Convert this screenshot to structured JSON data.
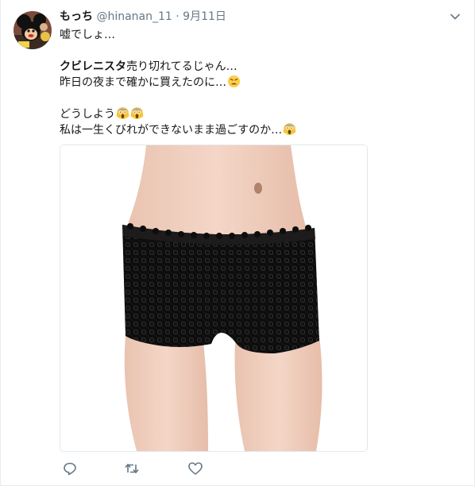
{
  "tweet": {
    "author_name": "もっち",
    "author_handle": "@hinanan_11",
    "separator": "·",
    "date": "9月11日",
    "lines": {
      "l1": "嘘でしょ…",
      "l2_bold": "クビレニスタ",
      "l2_rest": "売り切れてるじゃん…",
      "l3": "昨日の夜まで確かに買えたのに…",
      "l4": "どうしよう",
      "l5": "私は一生くびれができないまま過ごすのか…"
    },
    "emojis": {
      "l3": "weary-face",
      "l4": [
        "scream-face",
        "scream-face"
      ],
      "l5": "scream-face"
    }
  },
  "media": {
    "alt": "black lace boyshort panties on model"
  },
  "actions": [
    "reply-icon",
    "retweet-icon",
    "like-icon"
  ],
  "colors": {
    "text": "#14171a",
    "secondary": "#657786",
    "border": "#e1e8ed",
    "icon": "#657786"
  }
}
